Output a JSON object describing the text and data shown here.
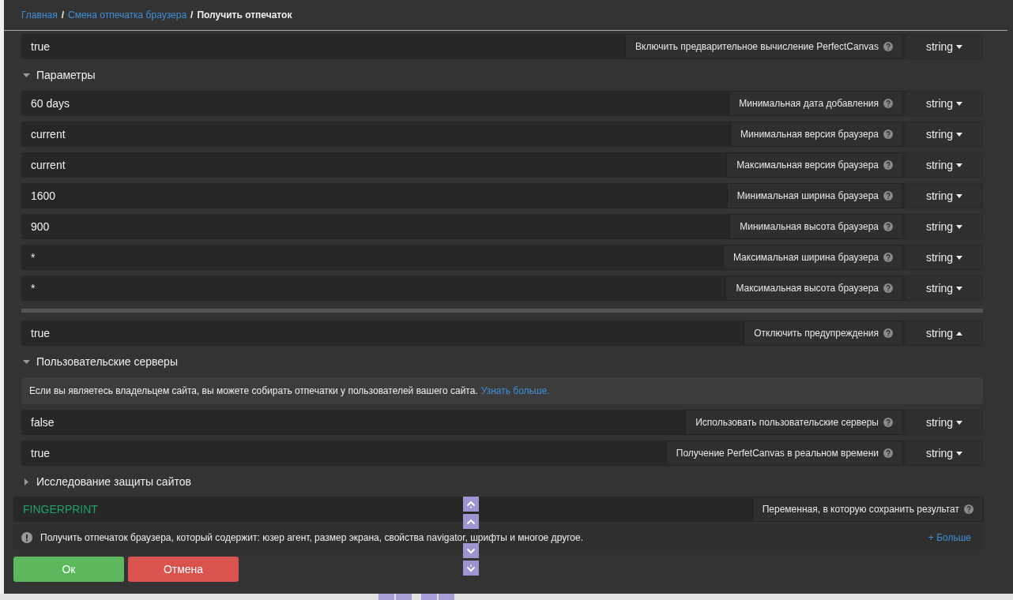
{
  "breadcrumb_separator": "/",
  "breadcrumb": [
    {
      "label": "Главная",
      "kind": "link"
    },
    {
      "label": "Смена отпечатка браузера",
      "kind": "link"
    },
    {
      "label": "Получить отпечаток",
      "kind": "current"
    }
  ],
  "items": [
    {
      "kind": "field",
      "value": "true",
      "label": "Включить предварительное вычисление PerfectCanvas",
      "type": "string",
      "dropdown_open": false
    },
    {
      "kind": "section",
      "title": "Параметры",
      "expanded": true
    },
    {
      "kind": "field",
      "value": "60 days",
      "label": "Минимальная дата добавления",
      "type": "string",
      "dropdown_open": false
    },
    {
      "kind": "field",
      "value": "current",
      "label": "Минимальная версия браузера",
      "type": "string",
      "dropdown_open": false
    },
    {
      "kind": "field",
      "value": "current",
      "label": "Максимальная версия браузера",
      "type": "string",
      "dropdown_open": false
    },
    {
      "kind": "field",
      "value": "1600",
      "label": "Минимальная ширина браузера",
      "type": "string",
      "dropdown_open": false
    },
    {
      "kind": "field",
      "value": "900",
      "label": "Минимальная высота браузера",
      "type": "string",
      "dropdown_open": false
    },
    {
      "kind": "field",
      "value": "*",
      "label": "Максимальная ширина браузера",
      "type": "string",
      "dropdown_open": false
    },
    {
      "kind": "field",
      "value": "*",
      "label": "Максимальная высота браузера",
      "type": "string",
      "dropdown_open": false
    },
    {
      "kind": "divider"
    },
    {
      "kind": "field",
      "value": "true",
      "label": "Отключить предупреждения",
      "type": "string",
      "dropdown_open": true
    },
    {
      "kind": "section",
      "title": "Пользовательские серверы",
      "expanded": true
    },
    {
      "kind": "info",
      "text": "Если вы являетесь владельцем сайта, вы можете собирать отпечатки у пользователей вашего сайта.",
      "link": "Узнать больше."
    },
    {
      "kind": "field",
      "value": "false",
      "label": "Использовать пользовательские серверы",
      "type": "string",
      "dropdown_open": false
    },
    {
      "kind": "field",
      "value": "true",
      "label": "Получение PerfetCanvas в реальном времени",
      "type": "string",
      "dropdown_open": false
    },
    {
      "kind": "section",
      "title": "Исследование защиты сайтов",
      "expanded": false
    }
  ],
  "result": {
    "variable": "FINGERPRINT",
    "label": "Переменная, в которую сохранить результат"
  },
  "description": {
    "text": "Получить отпечаток браузера, который содержит: юзер агент, размер экрана, свойства navigator, шрифты и многое другое.",
    "more": "+ Больше"
  },
  "buttons": [
    {
      "label": "Ок",
      "kind": "ok"
    },
    {
      "label": "Отмена",
      "kind": "cancel"
    }
  ]
}
